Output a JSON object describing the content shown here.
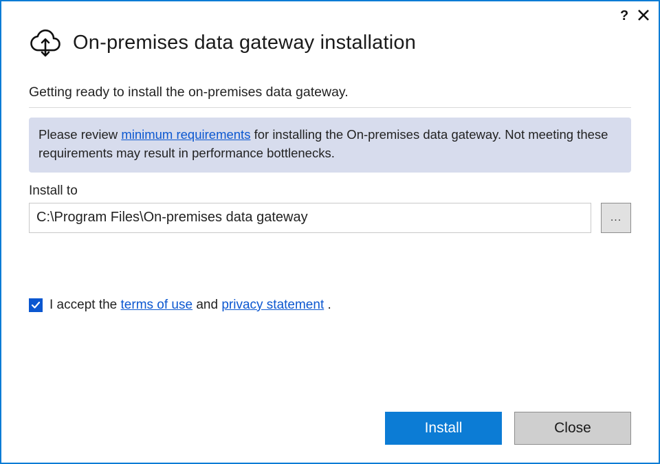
{
  "window": {
    "title": "On-premises data gateway installation",
    "subtitle": "Getting ready to install the on-premises data gateway."
  },
  "info": {
    "prefix": "Please review ",
    "link": "minimum requirements",
    "suffix": " for installing the On-premises data gateway. Not meeting these requirements may result in performance bottlenecks."
  },
  "install_to": {
    "label": "Install to",
    "path": "C:\\Program Files\\On-premises data gateway",
    "browse_label": "..."
  },
  "accept": {
    "checked": true,
    "prefix": "I accept the ",
    "terms_link": "terms of use",
    "middle": " and ",
    "privacy_link": "privacy statement",
    "suffix": " ."
  },
  "buttons": {
    "install": "Install",
    "close": "Close"
  }
}
